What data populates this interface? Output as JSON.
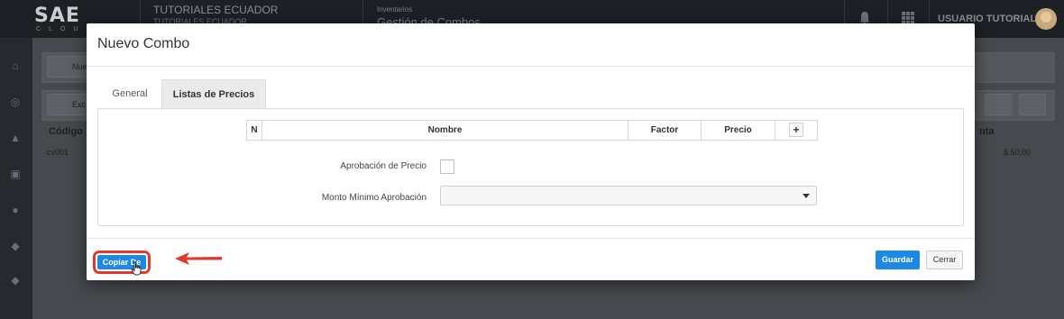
{
  "app": {
    "logo_main": "SAE",
    "logo_sub": "CLOUD",
    "company_name": "TUTORIALES ECUADOR",
    "company_sub": "TUTORIALES ECUADOR",
    "module_section": "Inventarios",
    "module_title": "Gestión de Combos",
    "user_name": "USUARIO TUTORIALES",
    "bg_button_1": "Nue",
    "bg_button_2": "Exc",
    "bg_col_codigo": "Código",
    "bg_col_venta": "nta",
    "bg_row_code": "cv001",
    "bg_row_price": "$ 50,00"
  },
  "modal": {
    "title": "Nuevo Combo",
    "tabs": [
      {
        "label": "General",
        "active": false
      },
      {
        "label": "Listas de Precios",
        "active": true
      }
    ],
    "table_headers": [
      "N",
      "Nombre",
      "Factor",
      "Precio"
    ],
    "add_label": "+",
    "aprobacion_label": "Aprobación de Precio",
    "monto_label": "Monto Mínimo Aprobación",
    "monto_value": "",
    "copiar_label": "Copiar De",
    "guardar_label": "Guardar",
    "cerrar_label": "Cerrar"
  },
  "colors": {
    "primary": "#1e88e5",
    "highlight": "#e03a2f"
  }
}
